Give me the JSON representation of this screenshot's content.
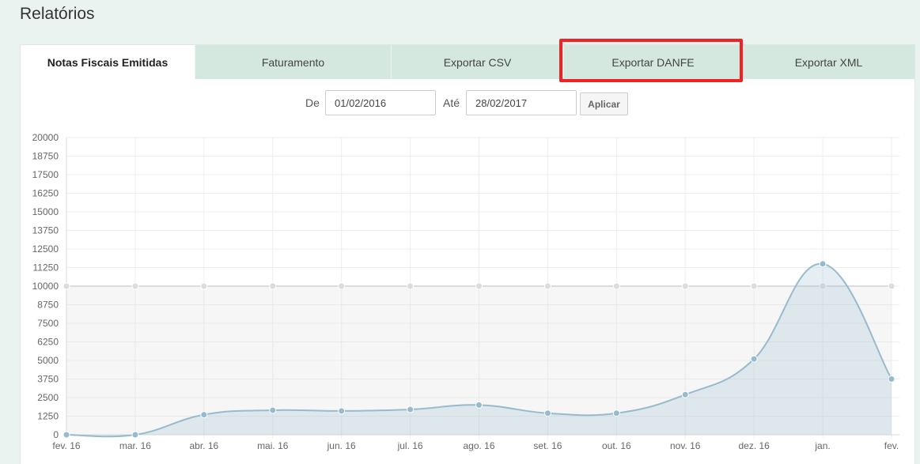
{
  "page": {
    "title": "Relatórios"
  },
  "tabs": [
    {
      "label": "Notas Fiscais Emitidas",
      "active": true
    },
    {
      "label": "Faturamento",
      "active": false
    },
    {
      "label": "Exportar CSV",
      "active": false
    },
    {
      "label": "Exportar DANFE",
      "active": false,
      "highlighted": true
    },
    {
      "label": "Exportar XML",
      "active": false
    }
  ],
  "filter": {
    "from_label": "De",
    "from_value": "01/02/2016",
    "to_label": "Até",
    "to_value": "28/02/2017",
    "apply_label": "Aplicar"
  },
  "colors": {
    "background": "#eaf3ef",
    "tab_inactive": "#d4e8df",
    "highlight": "#f22222",
    "series_line": "#97bbcd",
    "series_fill": "rgba(151,187,205,0.25)",
    "limit_line": "#dcdcdc"
  },
  "chart_data": {
    "type": "area",
    "x": [
      "fev. 16",
      "mar. 16",
      "abr. 16",
      "mai. 16",
      "jun. 16",
      "jul. 16",
      "ago. 16",
      "set. 16",
      "out. 16",
      "nov. 16",
      "dez. 16",
      "jan.",
      "fev."
    ],
    "y_ticks": [
      0,
      1250,
      2500,
      3750,
      5000,
      6250,
      7500,
      8750,
      10000,
      11250,
      12500,
      13750,
      15000,
      16250,
      17500,
      18750,
      20000
    ],
    "ylim": [
      0,
      20000
    ],
    "grid": true,
    "series": [
      {
        "values": [
          10000,
          10000,
          10000,
          10000,
          10000,
          10000,
          10000,
          10000,
          10000,
          10000,
          10000,
          10000,
          10000
        ],
        "color": "#dcdcdc"
      },
      {
        "values": [
          0,
          0,
          1350,
          1650,
          1600,
          1700,
          2000,
          1450,
          1450,
          2700,
          5100,
          11500,
          3750
        ],
        "color": "#97bbcd"
      }
    ]
  }
}
